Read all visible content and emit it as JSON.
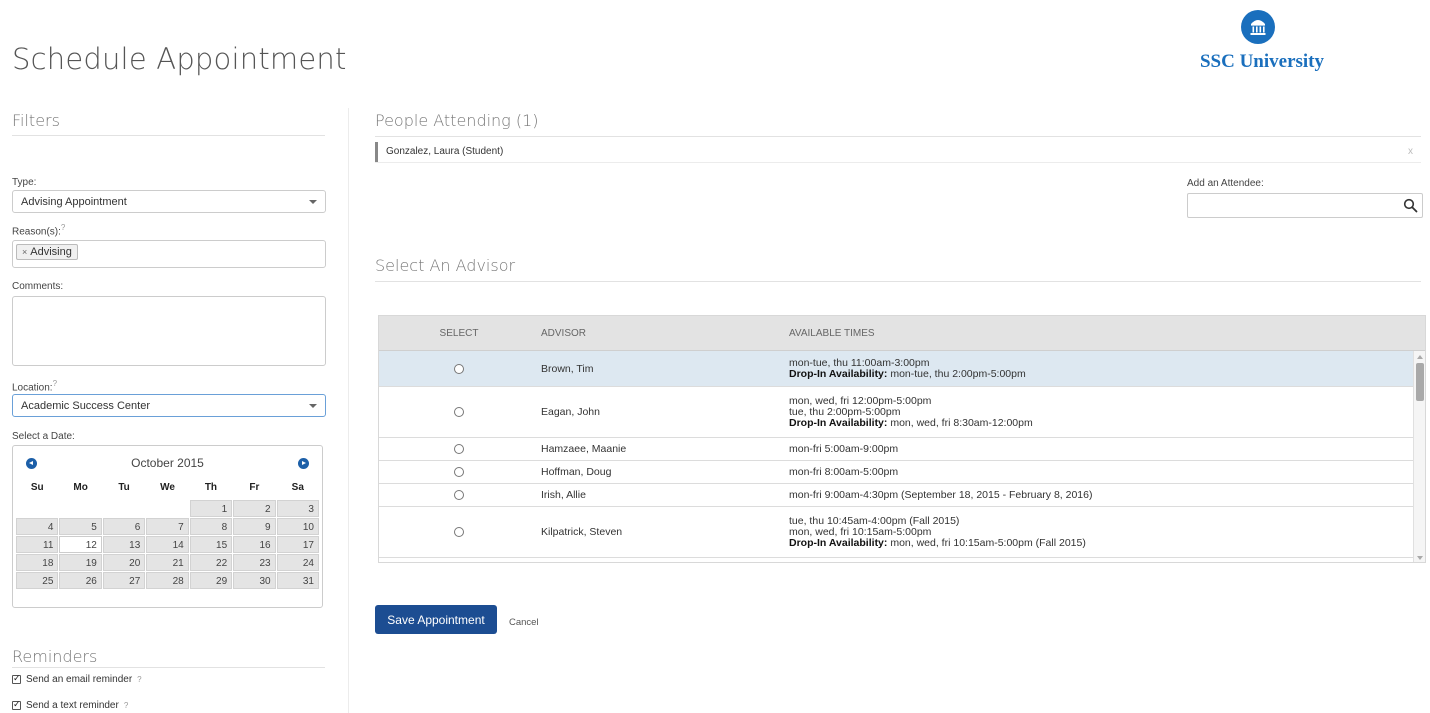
{
  "page_title": "Schedule Appointment",
  "brand": {
    "name": "SSC University",
    "color": "#1a6fbd",
    "icon": "university-building-icon"
  },
  "filters": {
    "heading": "Filters",
    "type_label": "Type:",
    "type_value": "Advising Appointment",
    "reasons_label": "Reason(s):",
    "reasons_help": "?",
    "reason_tag": "Advising",
    "reason_tag_remove": "×",
    "comments_label": "Comments:",
    "location_label": "Location:",
    "location_help": "?",
    "location_value": "Academic Success Center",
    "date_label": "Select a Date:"
  },
  "calendar": {
    "month_label": "October 2015",
    "days_of_week": [
      "Su",
      "Mo",
      "Tu",
      "We",
      "Th",
      "Fr",
      "Sa"
    ],
    "weeks": [
      [
        "",
        "",
        "",
        "",
        "1",
        "2",
        "3"
      ],
      [
        "4",
        "5",
        "6",
        "7",
        "8",
        "9",
        "10"
      ],
      [
        "11",
        "12",
        "13",
        "14",
        "15",
        "16",
        "17"
      ],
      [
        "18",
        "19",
        "20",
        "21",
        "22",
        "23",
        "24"
      ],
      [
        "25",
        "26",
        "27",
        "28",
        "29",
        "30",
        "31"
      ]
    ],
    "highlighted_day": "12"
  },
  "reminders": {
    "heading": "Reminders",
    "email_label": "Send an email reminder",
    "text_label": "Send a text reminder",
    "help": "?"
  },
  "people": {
    "heading": "People Attending (1)",
    "attendees": [
      {
        "name": "Gonzalez, Laura (Student)",
        "remove": "x"
      }
    ],
    "add_label": "Add an Attendee:",
    "add_placeholder": ""
  },
  "advisors": {
    "heading": "Select An Advisor",
    "columns": [
      "SELECT",
      "ADVISOR",
      "AVAILABLE TIMES"
    ],
    "rows": [
      {
        "name": "Brown, Tim",
        "selected": true,
        "times": [
          "mon-tue, thu 11:00am-3:00pm"
        ],
        "dropin_label": "Drop-In Availability:",
        "dropin": "mon-tue, thu 2:00pm-5:00pm"
      },
      {
        "name": "Eagan, John",
        "selected": false,
        "times": [
          "mon, wed, fri 12:00pm-5:00pm",
          "tue, thu 2:00pm-5:00pm"
        ],
        "dropin_label": "Drop-In Availability:",
        "dropin": "mon, wed, fri 8:30am-12:00pm"
      },
      {
        "name": "Hamzaee, Maanie",
        "selected": false,
        "times": [
          "mon-fri 5:00am-9:00pm"
        ],
        "dropin_label": "",
        "dropin": ""
      },
      {
        "name": "Hoffman, Doug",
        "selected": false,
        "times": [
          "mon-fri 8:00am-5:00pm"
        ],
        "dropin_label": "",
        "dropin": ""
      },
      {
        "name": "Irish, Allie",
        "selected": false,
        "times": [
          "mon-fri 9:00am-4:30pm (September 18, 2015 - February 8, 2016)"
        ],
        "dropin_label": "",
        "dropin": ""
      },
      {
        "name": "Kilpatrick, Steven",
        "selected": false,
        "times": [
          "tue, thu 10:45am-4:00pm (Fall 2015)",
          "mon, wed, fri 10:15am-5:00pm"
        ],
        "dropin_label": "Drop-In Availability:",
        "dropin": "mon, wed, fri 10:15am-5:00pm (Fall 2015)"
      }
    ]
  },
  "actions": {
    "save_label": "Save Appointment",
    "cancel_label": "Cancel"
  },
  "colors": {
    "primary_button": "#1c4d92",
    "selected_row": "#dde8f1",
    "calendar_nav": "#1c5fa8"
  }
}
